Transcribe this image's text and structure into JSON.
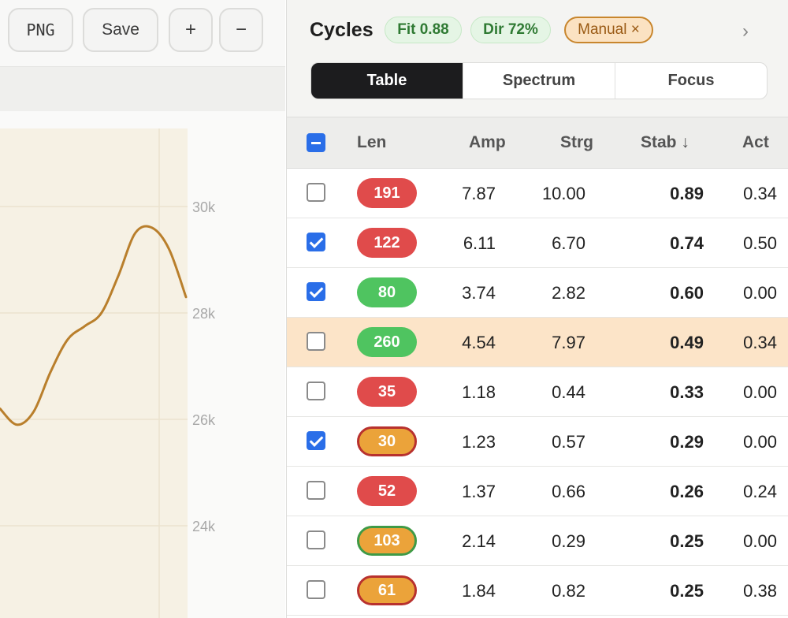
{
  "toolbar": {
    "png": "PNG",
    "save": "Save",
    "zoom_in": "+",
    "zoom_out": "−"
  },
  "chart": {
    "y_ticks": [
      "30k",
      "28k",
      "26k",
      "24k"
    ],
    "background": "#f6f1e4",
    "line_color": "#b97f2c"
  },
  "chart_data": {
    "type": "line",
    "title": "",
    "xlabel": "",
    "ylabel": "",
    "yticks": [
      24000,
      26000,
      28000,
      30000
    ],
    "ylim": [
      22000,
      32000
    ],
    "series": [
      {
        "values": [
          26200,
          25900,
          26150,
          26900,
          27500,
          27750,
          28000,
          28700,
          29500,
          29600,
          29200,
          28300
        ]
      }
    ]
  },
  "panel": {
    "title": "Cycles",
    "chips": {
      "fit": "Fit 0.88",
      "dir": "Dir 72%",
      "manual": "Manual ×"
    },
    "chevron": "›",
    "tabs": [
      "Table",
      "Spectrum",
      "Focus"
    ],
    "columns": {
      "len": "Len",
      "amp": "Amp",
      "strg": "Strg",
      "stab": "Stab ↓",
      "act": "Act"
    },
    "colors": {
      "red": "#e04b4b",
      "green": "#4fc460",
      "amber": "#eba33a",
      "checkbox": "#2a6ee8",
      "highlight": "#fce4c8"
    },
    "rows": [
      {
        "len": "191",
        "color": "red",
        "ring": "",
        "amp": "7.87",
        "strg": "10.00",
        "stab": "0.89",
        "act": "0.34",
        "checked": false,
        "highlight": false
      },
      {
        "len": "122",
        "color": "red",
        "ring": "",
        "amp": "6.11",
        "strg": "6.70",
        "stab": "0.74",
        "act": "0.50",
        "checked": true,
        "highlight": false
      },
      {
        "len": "80",
        "color": "green",
        "ring": "",
        "amp": "3.74",
        "strg": "2.82",
        "stab": "0.60",
        "act": "0.00",
        "checked": true,
        "highlight": false
      },
      {
        "len": "260",
        "color": "green",
        "ring": "",
        "amp": "4.54",
        "strg": "7.97",
        "stab": "0.49",
        "act": "0.34",
        "checked": false,
        "highlight": true
      },
      {
        "len": "35",
        "color": "red",
        "ring": "",
        "amp": "1.18",
        "strg": "0.44",
        "stab": "0.33",
        "act": "0.00",
        "checked": false,
        "highlight": false
      },
      {
        "len": "30",
        "color": "amber",
        "ring": "red",
        "amp": "1.23",
        "strg": "0.57",
        "stab": "0.29",
        "act": "0.00",
        "checked": true,
        "highlight": false
      },
      {
        "len": "52",
        "color": "red",
        "ring": "",
        "amp": "1.37",
        "strg": "0.66",
        "stab": "0.26",
        "act": "0.24",
        "checked": false,
        "highlight": false
      },
      {
        "len": "103",
        "color": "amber",
        "ring": "green",
        "amp": "2.14",
        "strg": "0.29",
        "stab": "0.25",
        "act": "0.00",
        "checked": false,
        "highlight": false
      },
      {
        "len": "61",
        "color": "amber",
        "ring": "red",
        "amp": "1.84",
        "strg": "0.82",
        "stab": "0.25",
        "act": "0.38",
        "checked": false,
        "highlight": false
      }
    ]
  }
}
